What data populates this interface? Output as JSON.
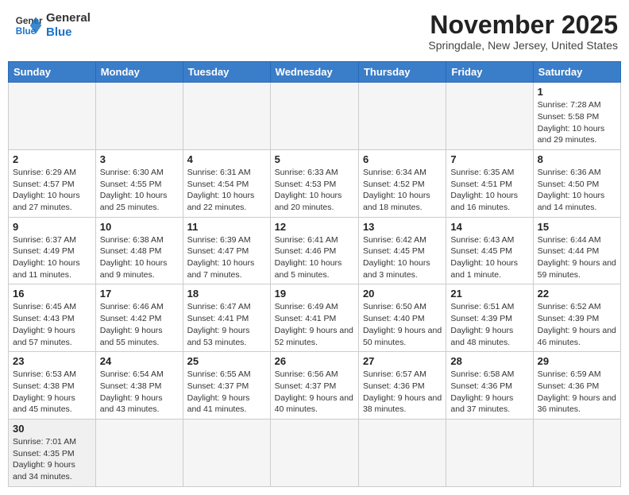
{
  "header": {
    "logo_line1": "General",
    "logo_line2": "Blue",
    "month": "November 2025",
    "location": "Springdale, New Jersey, United States"
  },
  "weekdays": [
    "Sunday",
    "Monday",
    "Tuesday",
    "Wednesday",
    "Thursday",
    "Friday",
    "Saturday"
  ],
  "weeks": [
    [
      {
        "day": "",
        "info": ""
      },
      {
        "day": "",
        "info": ""
      },
      {
        "day": "",
        "info": ""
      },
      {
        "day": "",
        "info": ""
      },
      {
        "day": "",
        "info": ""
      },
      {
        "day": "",
        "info": ""
      },
      {
        "day": "1",
        "info": "Sunrise: 7:28 AM\nSunset: 5:58 PM\nDaylight: 10 hours and 29 minutes."
      }
    ],
    [
      {
        "day": "2",
        "info": "Sunrise: 6:29 AM\nSunset: 4:57 PM\nDaylight: 10 hours and 27 minutes."
      },
      {
        "day": "3",
        "info": "Sunrise: 6:30 AM\nSunset: 4:55 PM\nDaylight: 10 hours and 25 minutes."
      },
      {
        "day": "4",
        "info": "Sunrise: 6:31 AM\nSunset: 4:54 PM\nDaylight: 10 hours and 22 minutes."
      },
      {
        "day": "5",
        "info": "Sunrise: 6:33 AM\nSunset: 4:53 PM\nDaylight: 10 hours and 20 minutes."
      },
      {
        "day": "6",
        "info": "Sunrise: 6:34 AM\nSunset: 4:52 PM\nDaylight: 10 hours and 18 minutes."
      },
      {
        "day": "7",
        "info": "Sunrise: 6:35 AM\nSunset: 4:51 PM\nDaylight: 10 hours and 16 minutes."
      },
      {
        "day": "8",
        "info": "Sunrise: 6:36 AM\nSunset: 4:50 PM\nDaylight: 10 hours and 14 minutes."
      }
    ],
    [
      {
        "day": "9",
        "info": "Sunrise: 6:37 AM\nSunset: 4:49 PM\nDaylight: 10 hours and 11 minutes."
      },
      {
        "day": "10",
        "info": "Sunrise: 6:38 AM\nSunset: 4:48 PM\nDaylight: 10 hours and 9 minutes."
      },
      {
        "day": "11",
        "info": "Sunrise: 6:39 AM\nSunset: 4:47 PM\nDaylight: 10 hours and 7 minutes."
      },
      {
        "day": "12",
        "info": "Sunrise: 6:41 AM\nSunset: 4:46 PM\nDaylight: 10 hours and 5 minutes."
      },
      {
        "day": "13",
        "info": "Sunrise: 6:42 AM\nSunset: 4:45 PM\nDaylight: 10 hours and 3 minutes."
      },
      {
        "day": "14",
        "info": "Sunrise: 6:43 AM\nSunset: 4:45 PM\nDaylight: 10 hours and 1 minute."
      },
      {
        "day": "15",
        "info": "Sunrise: 6:44 AM\nSunset: 4:44 PM\nDaylight: 9 hours and 59 minutes."
      }
    ],
    [
      {
        "day": "16",
        "info": "Sunrise: 6:45 AM\nSunset: 4:43 PM\nDaylight: 9 hours and 57 minutes."
      },
      {
        "day": "17",
        "info": "Sunrise: 6:46 AM\nSunset: 4:42 PM\nDaylight: 9 hours and 55 minutes."
      },
      {
        "day": "18",
        "info": "Sunrise: 6:47 AM\nSunset: 4:41 PM\nDaylight: 9 hours and 53 minutes."
      },
      {
        "day": "19",
        "info": "Sunrise: 6:49 AM\nSunset: 4:41 PM\nDaylight: 9 hours and 52 minutes."
      },
      {
        "day": "20",
        "info": "Sunrise: 6:50 AM\nSunset: 4:40 PM\nDaylight: 9 hours and 50 minutes."
      },
      {
        "day": "21",
        "info": "Sunrise: 6:51 AM\nSunset: 4:39 PM\nDaylight: 9 hours and 48 minutes."
      },
      {
        "day": "22",
        "info": "Sunrise: 6:52 AM\nSunset: 4:39 PM\nDaylight: 9 hours and 46 minutes."
      }
    ],
    [
      {
        "day": "23",
        "info": "Sunrise: 6:53 AM\nSunset: 4:38 PM\nDaylight: 9 hours and 45 minutes."
      },
      {
        "day": "24",
        "info": "Sunrise: 6:54 AM\nSunset: 4:38 PM\nDaylight: 9 hours and 43 minutes."
      },
      {
        "day": "25",
        "info": "Sunrise: 6:55 AM\nSunset: 4:37 PM\nDaylight: 9 hours and 41 minutes."
      },
      {
        "day": "26",
        "info": "Sunrise: 6:56 AM\nSunset: 4:37 PM\nDaylight: 9 hours and 40 minutes."
      },
      {
        "day": "27",
        "info": "Sunrise: 6:57 AM\nSunset: 4:36 PM\nDaylight: 9 hours and 38 minutes."
      },
      {
        "day": "28",
        "info": "Sunrise: 6:58 AM\nSunset: 4:36 PM\nDaylight: 9 hours and 37 minutes."
      },
      {
        "day": "29",
        "info": "Sunrise: 6:59 AM\nSunset: 4:36 PM\nDaylight: 9 hours and 36 minutes."
      }
    ],
    [
      {
        "day": "30",
        "info": "Sunrise: 7:01 AM\nSunset: 4:35 PM\nDaylight: 9 hours and 34 minutes."
      },
      {
        "day": "",
        "info": ""
      },
      {
        "day": "",
        "info": ""
      },
      {
        "day": "",
        "info": ""
      },
      {
        "day": "",
        "info": ""
      },
      {
        "day": "",
        "info": ""
      },
      {
        "day": "",
        "info": ""
      }
    ]
  ]
}
